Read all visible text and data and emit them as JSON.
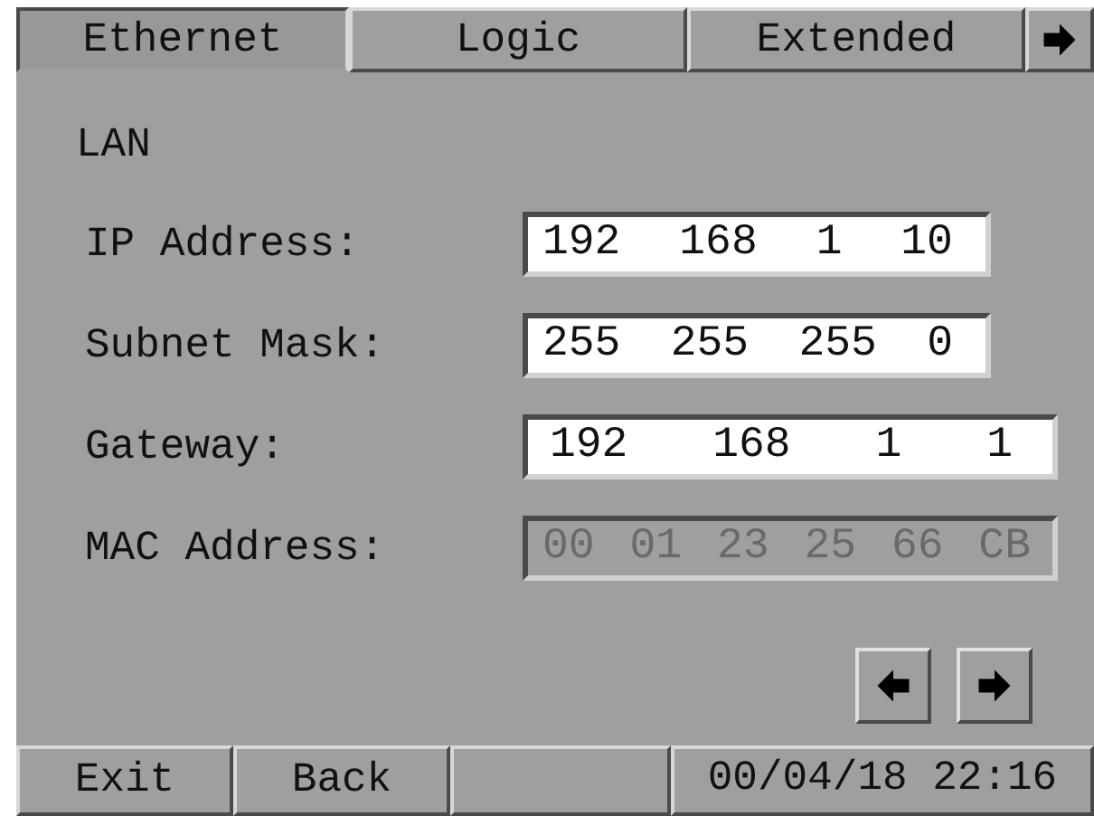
{
  "tabs": [
    {
      "label": "Ethernet",
      "selected": true
    },
    {
      "label": "Logic",
      "selected": false
    },
    {
      "label": "Extended",
      "selected": false
    }
  ],
  "section": "LAN",
  "fields": [
    {
      "label": "IP Address:",
      "octets": [
        "192",
        "168",
        "1",
        "10"
      ],
      "disabled": false
    },
    {
      "label": "Subnet Mask:",
      "octets": [
        "255",
        "255",
        "255",
        "0"
      ],
      "disabled": false
    },
    {
      "label": "Gateway:",
      "octets": [
        "192",
        "168",
        "1",
        "1"
      ],
      "disabled": false
    },
    {
      "label": "MAC Address:",
      "octets": [
        "00",
        "01",
        "23",
        "25",
        "66",
        "CB"
      ],
      "disabled": true
    }
  ],
  "bottom_bar": {
    "buttons": [
      "Exit",
      "Back"
    ],
    "datetime": "00/04/18 22:16"
  }
}
